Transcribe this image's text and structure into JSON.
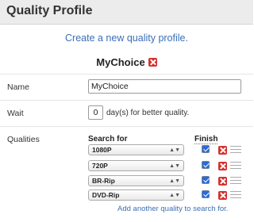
{
  "header": {
    "title": "Quality Profile"
  },
  "create_link": "Create a new quality profile.",
  "profile": {
    "name": "MyChoice"
  },
  "fields": {
    "name_label": "Name",
    "name_value": "MyChoice",
    "wait_label": "Wait",
    "wait_value": "0",
    "wait_suffix": "day(s) for better quality.",
    "qualities_label": "Qualities"
  },
  "qualities": {
    "search_header": "Search for",
    "finish_header": "Finish",
    "rows": [
      {
        "quality": "1080P",
        "finish": true
      },
      {
        "quality": "720P",
        "finish": true
      },
      {
        "quality": "BR-Rip",
        "finish": true
      },
      {
        "quality": "DVD-Rip",
        "finish": true
      }
    ],
    "add_link": "Add another quality to search for."
  },
  "icons": {
    "delete": "delete-x-icon",
    "drag": "drag-handle-icon",
    "select_arrow": "select-arrows-icon"
  },
  "colors": {
    "link": "#3b6fb6",
    "delete": "#d2322d",
    "checkbox": "#2c6ad6",
    "header_bg": "#ececec"
  }
}
